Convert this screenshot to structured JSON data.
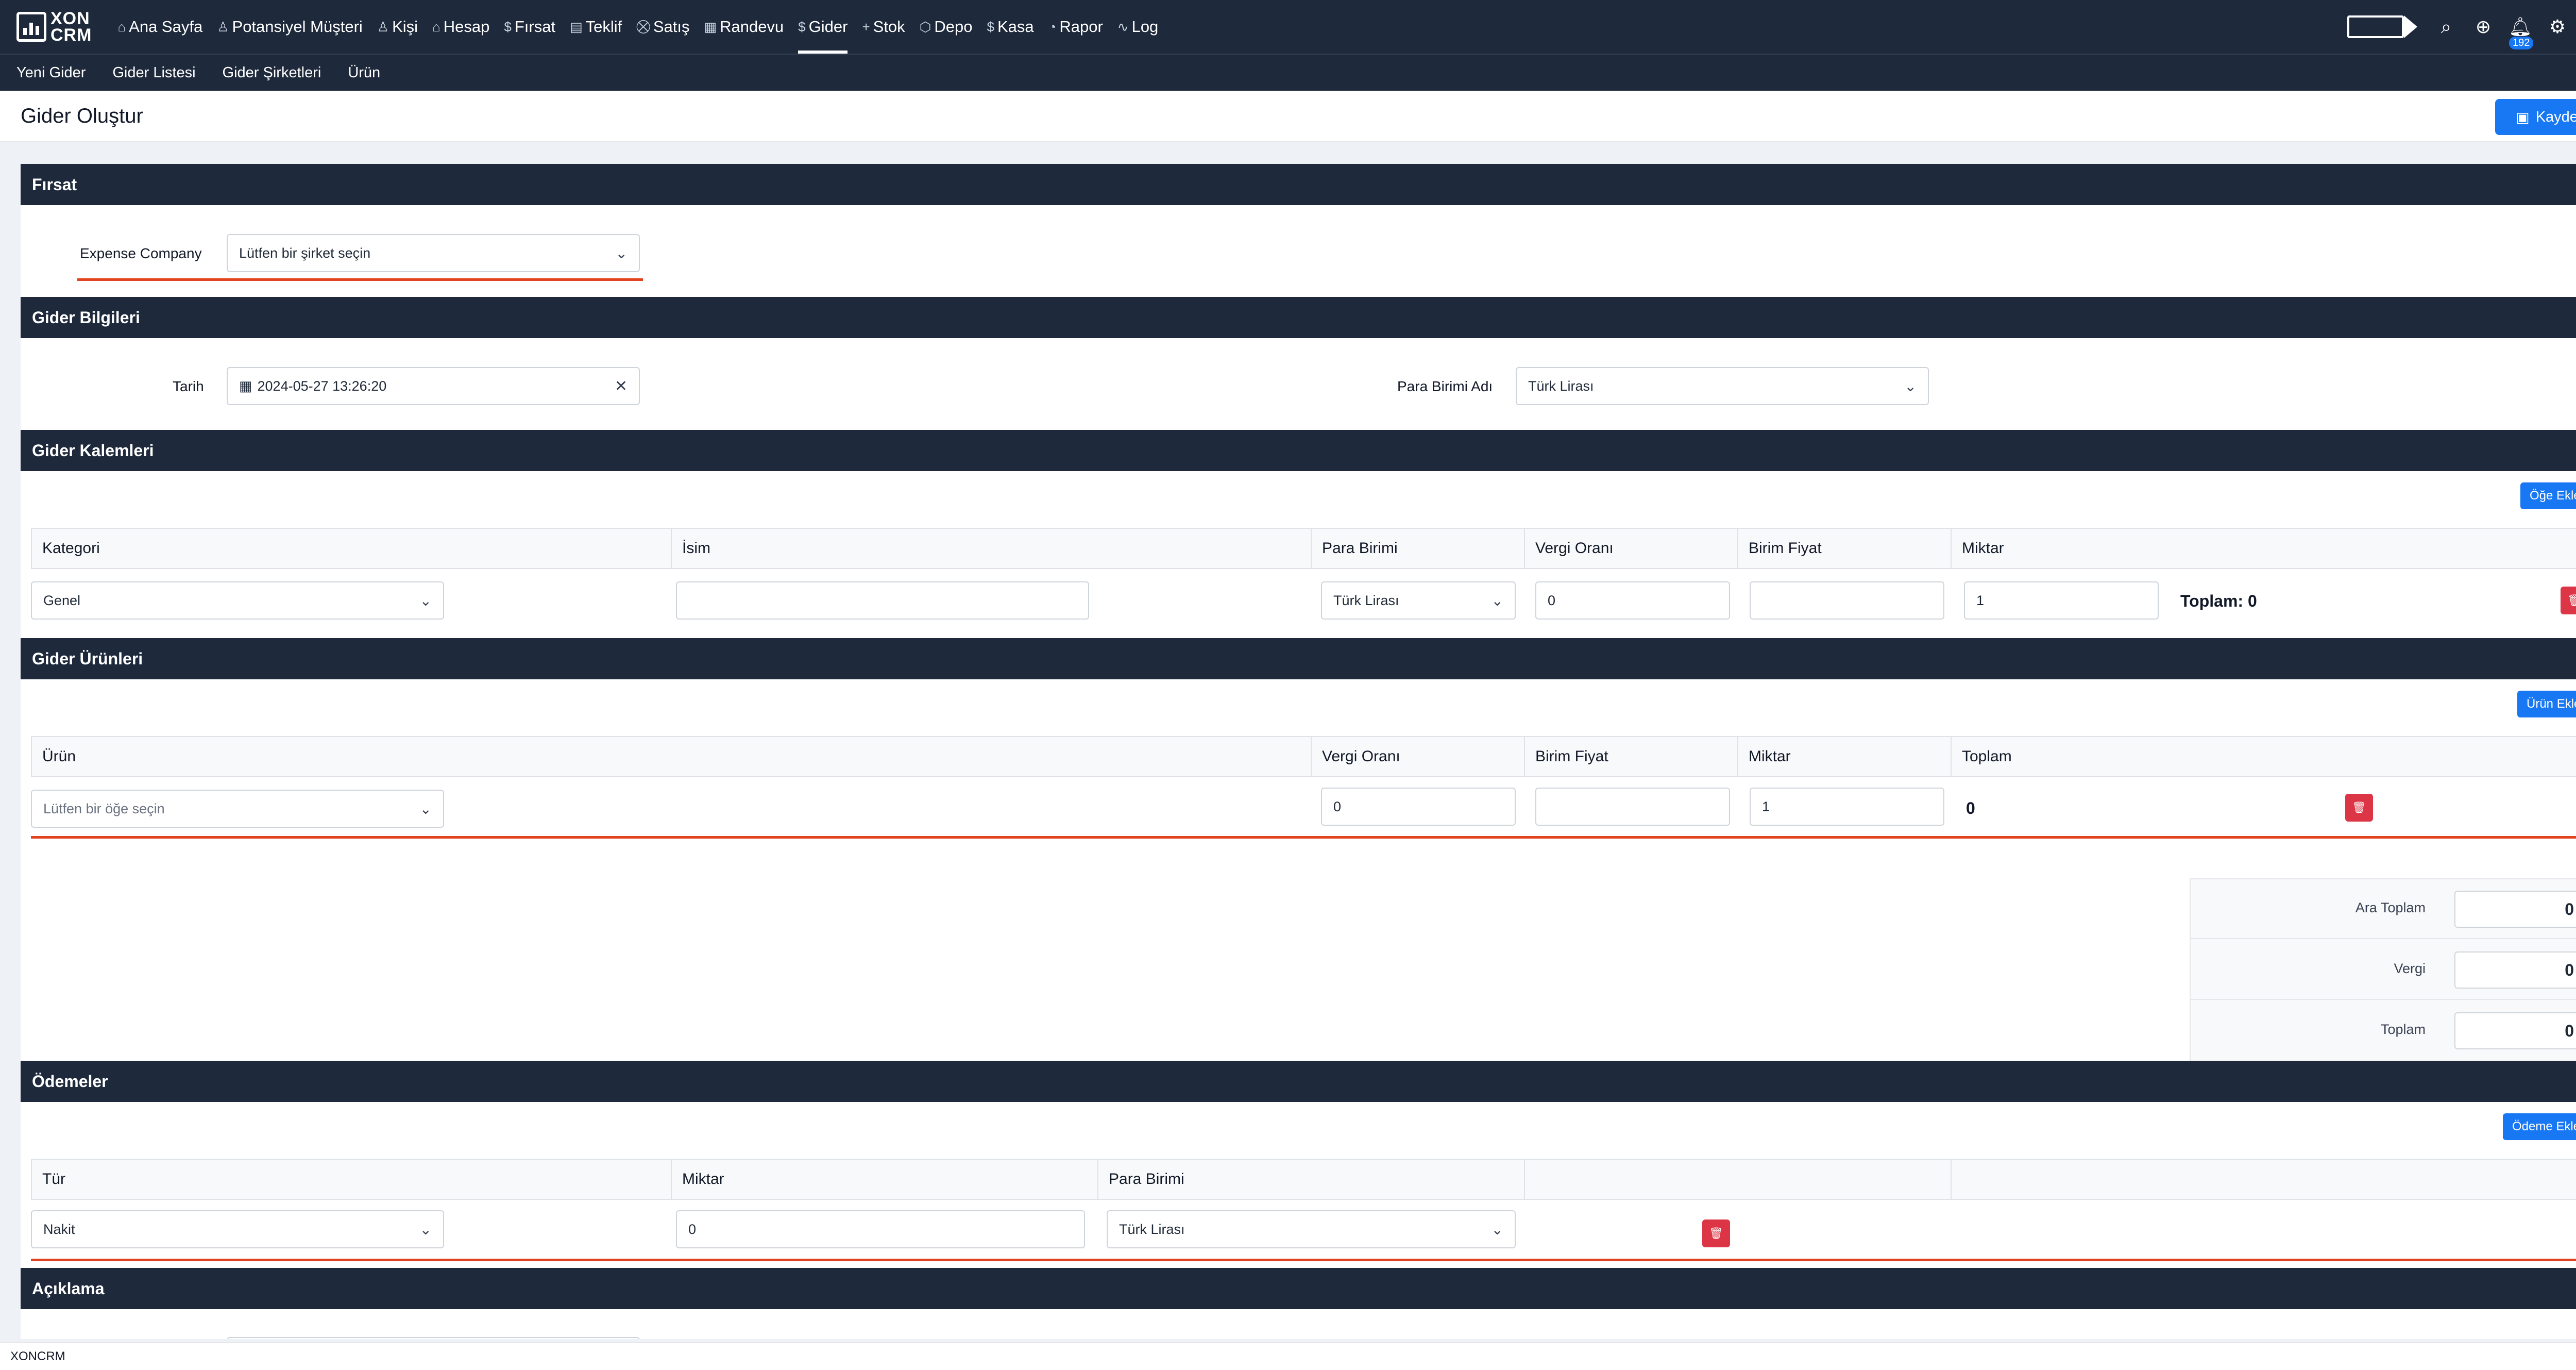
{
  "app": {
    "logo_line1": "XON",
    "logo_line2": "CRM",
    "status_text": "XONCRM"
  },
  "nav": [
    {
      "label": "Ana Sayfa",
      "icon": "⌂"
    },
    {
      "label": "Potansiyel Müşteri",
      "icon": "♙"
    },
    {
      "label": "Kişi",
      "icon": "♙"
    },
    {
      "label": "Hesap",
      "icon": "⌂"
    },
    {
      "label": "Fırsat",
      "icon": "$"
    },
    {
      "label": "Teklif",
      "icon": "▤"
    },
    {
      "label": "Satış",
      "icon": "⛒"
    },
    {
      "label": "Randevu",
      "icon": "▦"
    },
    {
      "label": "Gider",
      "icon": "$"
    },
    {
      "label": "Stok",
      "icon": "+"
    },
    {
      "label": "Depo",
      "icon": "⬡"
    },
    {
      "label": "Kasa",
      "icon": "$"
    },
    {
      "label": "Rapor",
      "icon": "◔"
    },
    {
      "label": "Log",
      "icon": "∿"
    }
  ],
  "notifications_count": "192",
  "subnav": [
    "Yeni Gider",
    "Gider Listesi",
    "Gider Şirketleri",
    "Ürün"
  ],
  "page": {
    "title": "Gider Oluştur",
    "save_label": "Kaydet"
  },
  "firsat": {
    "title": "Fırsat",
    "company_label": "Expense Company",
    "company_value": "Lütfen bir şirket seçin"
  },
  "bilgiler": {
    "title": "Gider Bilgileri",
    "date_label": "Tarih",
    "date_value": "2024-05-27 13:26:20",
    "currency_label": "Para Birimi Adı",
    "currency_value": "Türk Lirası"
  },
  "kalemler": {
    "title": "Gider Kalemleri",
    "add_label": "Öğe Ekle",
    "headers": [
      "Kategori",
      "İsim",
      "Para Birimi",
      "Vergi Oranı",
      "Birim Fiyat",
      "Miktar"
    ],
    "row": {
      "category": "Genel",
      "name": "",
      "currency": "Türk Lirası",
      "tax": "0",
      "unit_price": "",
      "quantity": "1",
      "total": "Toplam: 0"
    }
  },
  "urunler": {
    "title": "Gider Ürünleri",
    "add_label": "Ürün Ekle",
    "headers": [
      "Ürün",
      "Vergi Oranı",
      "Birim Fiyat",
      "Miktar",
      "Toplam"
    ],
    "row": {
      "product_placeholder": "Lütfen bir öğe seçin",
      "tax": "0",
      "unit_price": "",
      "quantity": "1",
      "total": "0"
    }
  },
  "totals": [
    {
      "label": "Ara Toplam",
      "value": "0"
    },
    {
      "label": "Vergi",
      "value": "0"
    },
    {
      "label": "Toplam",
      "value": "0"
    }
  ],
  "odemeler": {
    "title": "Ödemeler",
    "add_label": "Ödeme Ekle",
    "headers": [
      "Tür",
      "Miktar",
      "Para Birimi"
    ],
    "row": {
      "type": "Nakit",
      "amount": "0",
      "currency": "Türk Lirası"
    }
  },
  "aciklama": {
    "title": "Açıklama"
  }
}
